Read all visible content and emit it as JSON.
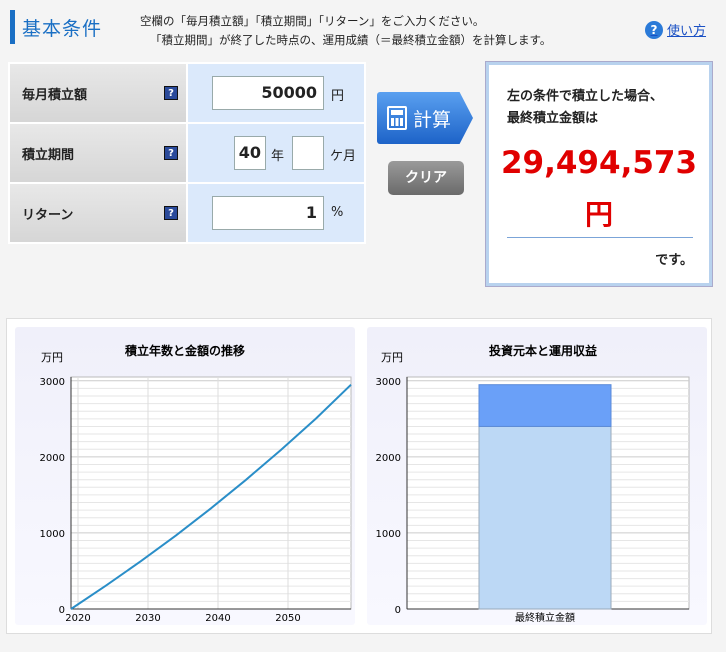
{
  "header": {
    "title": "基本条件",
    "instruction_line1": "空欄の「毎月積立額」「積立期間」「リターン」をご入力ください。",
    "instruction_line2": "「積立期間」が終了した時点の、運用成績（＝最終積立金額）を計算します。",
    "help_icon": "question-circle-icon",
    "help_label": "使い方"
  },
  "form": {
    "monthly": {
      "label": "毎月積立額",
      "value": "50000",
      "unit": "円"
    },
    "period": {
      "label": "積立期間",
      "years_value": "40",
      "years_unit": "年",
      "months_value": "",
      "months_unit": "ケ月"
    },
    "return": {
      "label": "リターン",
      "value": "1",
      "unit": "%"
    },
    "help_mark": "?"
  },
  "buttons": {
    "calculate": "計算",
    "clear": "クリア"
  },
  "result": {
    "line1": "左の条件で積立した場合、",
    "line2": "最終積立金額は",
    "amount": "29,494,573",
    "yen": "円",
    "suffix": "です。"
  },
  "colors": {
    "accent": "#1a6fc4",
    "result_red": "#e00000",
    "line": "#2a8ec8",
    "principal": "#bcd8f5",
    "gain": "#6aa0f8"
  },
  "chart_data": [
    {
      "type": "line",
      "title": "積立年数と金額の推移",
      "ylabel": "万円",
      "x_ticks": [
        2020,
        2030,
        2040,
        2050
      ],
      "y_ticks": [
        0,
        1000,
        2000,
        3000
      ],
      "xlim": [
        2019,
        2059
      ],
      "ylim": [
        0,
        3050
      ],
      "grid": true,
      "series": [
        {
          "x": [
            2019,
            2024,
            2029,
            2034,
            2039,
            2044,
            2049,
            2054,
            2059
          ],
          "values": [
            0,
            307,
            630,
            968,
            1324,
            1698,
            2091,
            2504,
            2949
          ]
        }
      ]
    },
    {
      "type": "bar",
      "title": "投資元本と運用収益",
      "ylabel": "万円",
      "categories": [
        "最終積立金額"
      ],
      "y_ticks": [
        0,
        1000,
        2000,
        3000
      ],
      "ylim": [
        0,
        3050
      ],
      "grid": true,
      "series": [
        {
          "values": [
            2400
          ]
        },
        {
          "values": [
            549
          ]
        }
      ]
    }
  ]
}
